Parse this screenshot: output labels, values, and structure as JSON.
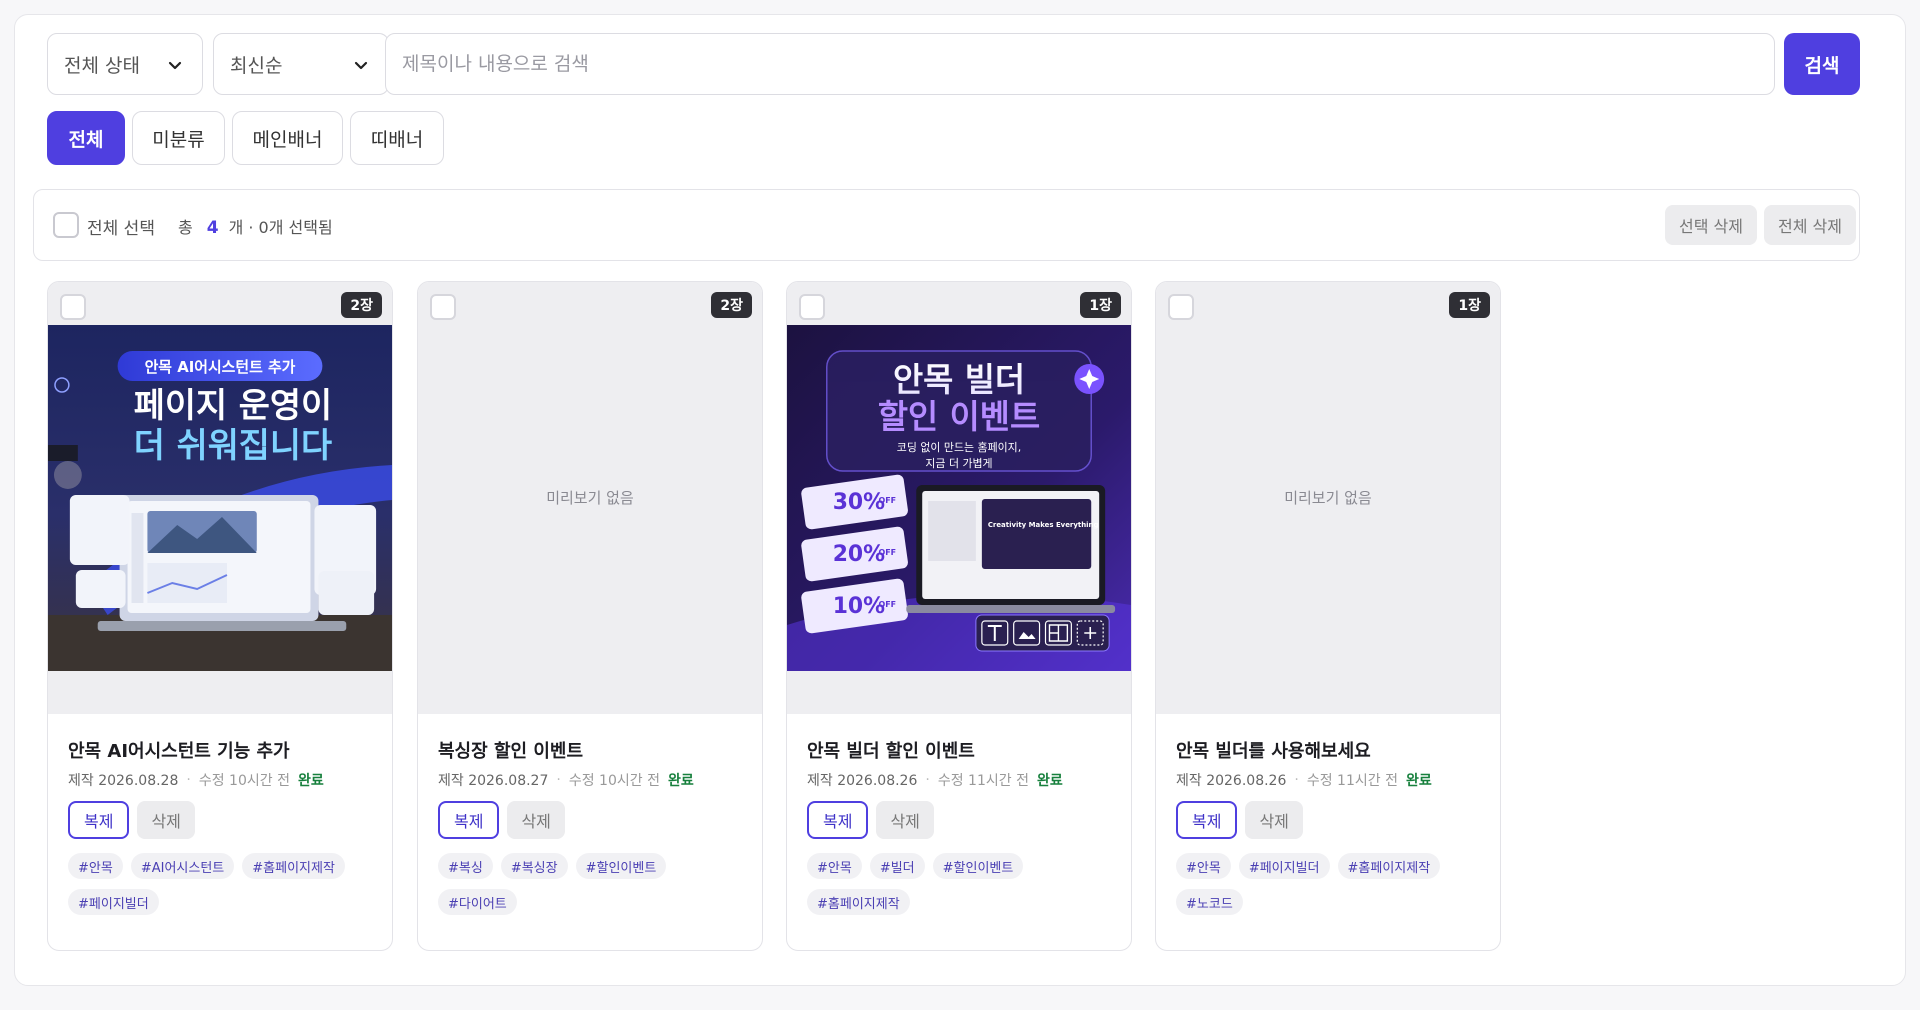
{
  "filters": {
    "status": {
      "selected": "전체 상태"
    },
    "sort": {
      "selected": "최신순"
    },
    "search": {
      "placeholder": "제목이나 내용으로 검색",
      "value": ""
    },
    "search_button": "검색"
  },
  "categories": [
    "전체",
    "미분류",
    "메인배너",
    "띠배너"
  ],
  "active_category": "전체",
  "selection": {
    "select_all_label": "전체 선택",
    "total_prefix": "총",
    "total": "4",
    "total_suffix": "개 · 0개 선택됨",
    "delete_selected": "선택 삭제",
    "delete_all": "전체 삭제"
  },
  "colors": {
    "accent": "#4f3fe0",
    "status_done": "#17803d"
  },
  "labels": {
    "no_preview": "미리보기 없음",
    "duplicate": "복제",
    "delete": "삭제"
  },
  "cards": [
    {
      "count_badge": "2장",
      "has_preview": true,
      "title": "안목 AI어시스턴트 기능 추가",
      "created": "제작 2026.08.28",
      "updated": "수정 10시간 전",
      "status": "완료",
      "tags": [
        "#안목",
        "#AI어시스턴트",
        "#홈페이지제작",
        "#페이지빌더"
      ],
      "preview": {
        "pill": "안목 AI어시스턴트 추가",
        "line1": "페이지 운영이",
        "line2": "더 쉬워집니다"
      }
    },
    {
      "count_badge": "2장",
      "has_preview": false,
      "title": "복싱장 할인 이벤트",
      "created": "제작 2026.08.27",
      "updated": "수정 10시간 전",
      "status": "완료",
      "tags": [
        "#복싱",
        "#복싱장",
        "#할인이벤트",
        "#다이어트"
      ]
    },
    {
      "count_badge": "1장",
      "has_preview": true,
      "title": "안목 빌더 할인 이벤트",
      "created": "제작 2026.08.26",
      "updated": "수정 11시간 전",
      "status": "완료",
      "tags": [
        "#안목",
        "#빌더",
        "#할인이벤트",
        "#홈페이지제작"
      ],
      "preview": {
        "line1": "안목 빌더",
        "line2": "할인 이벤트",
        "sub1": "코딩 없이 만드는 홈페이지,",
        "sub2": "지금 더 가볍게",
        "coupons": [
          "30%",
          "20%",
          "10%"
        ],
        "coupon_off": "OFF",
        "laptop_text": "Creativity Makes Everything"
      }
    },
    {
      "count_badge": "1장",
      "has_preview": false,
      "title": "안목 빌더를 사용해보세요",
      "created": "제작 2026.08.26",
      "updated": "수정 11시간 전",
      "status": "완료",
      "tags": [
        "#안목",
        "#페이지빌더",
        "#홈페이지제작",
        "#노코드"
      ]
    }
  ]
}
